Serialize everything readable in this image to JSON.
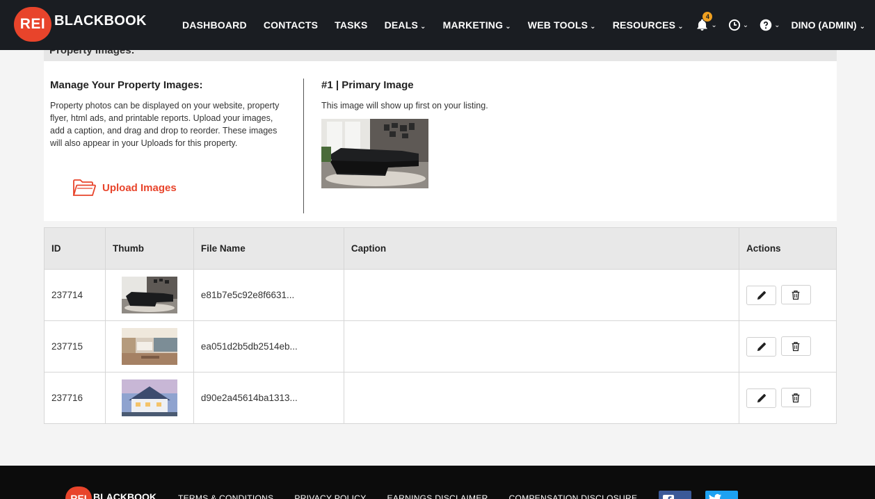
{
  "nav": {
    "logo_badge": "REI",
    "logo_text": "BLACKBOOK",
    "items": [
      {
        "label": "DASHBOARD",
        "dropdown": false
      },
      {
        "label": "CONTACTS",
        "dropdown": false
      },
      {
        "label": "TASKS",
        "dropdown": false
      },
      {
        "label": "DEALS",
        "dropdown": true
      },
      {
        "label": "MARKETING",
        "dropdown": true
      },
      {
        "label": "WEB TOOLS",
        "dropdown": true
      },
      {
        "label": "RESOURCES",
        "dropdown": true
      }
    ],
    "notification_count": "4",
    "user_label": "DINO (ADMIN)",
    "chevron": "⌄"
  },
  "section": {
    "title": "Property Images:"
  },
  "manage": {
    "title": "Manage Your Property Images:",
    "description": "Property photos can be displayed on your website, property flyer, html ads, and printable reports. Upload your images, add a caption, and drag and drop to reorder. These images will also appear in your Uploads for this property.",
    "upload_label": "Upload Images",
    "primary_title": "#1 | Primary Image",
    "primary_desc": "This image will show up first on your listing."
  },
  "table": {
    "headers": {
      "id": "ID",
      "thumb": "Thumb",
      "file_name": "File Name",
      "caption": "Caption",
      "actions": "Actions"
    },
    "rows": [
      {
        "id": "237714",
        "file_name": "e81b7e5c92e8f6631...",
        "caption": ""
      },
      {
        "id": "237715",
        "file_name": "ea051d2b5db2514eb...",
        "caption": ""
      },
      {
        "id": "237716",
        "file_name": "d90e2a45614ba1313...",
        "caption": ""
      }
    ]
  },
  "footer": {
    "logo_badge": "REI",
    "logo_text": "BLACKBOOK",
    "links": [
      "TERMS & CONDITIONS",
      "PRIVACY POLICY",
      "EARNINGS DISCLAIMER",
      "COMPENSATION DISCLOSURE"
    ]
  },
  "colors": {
    "nav_bg": "#1a1d22",
    "brand_red": "#e8442b",
    "badge": "#f0a020",
    "facebook": "#3b5998",
    "twitter": "#1da1f2"
  }
}
